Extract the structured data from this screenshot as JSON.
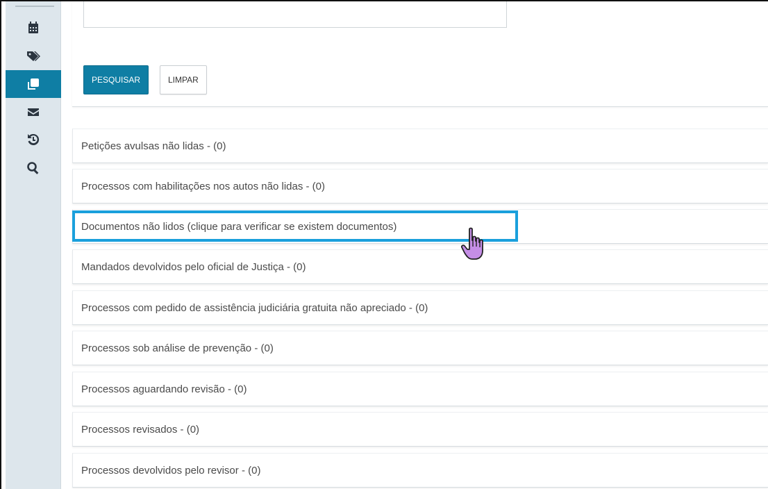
{
  "sidebar": {
    "items": [
      {
        "name": "calendar-icon",
        "active": false
      },
      {
        "name": "tags-icon",
        "active": false
      },
      {
        "name": "clone-icon",
        "active": true
      },
      {
        "name": "envelope-icon",
        "active": false
      },
      {
        "name": "history-icon",
        "active": false
      },
      {
        "name": "search-icon",
        "active": false
      }
    ]
  },
  "search": {
    "query": "",
    "search_button": "PESQUISAR",
    "clear_button": "LIMPAR"
  },
  "list": {
    "items": [
      {
        "label": "Petições avulsas não lidas - (0)"
      },
      {
        "label": "Processos com habilitações nos autos não lidas - (0)"
      },
      {
        "label": "Documentos não lidos (clique para verificar se existem documentos)"
      },
      {
        "label": "Mandados devolvidos pelo oficial de Justiça - (0)"
      },
      {
        "label": "Processos com pedido de assistência judiciária gratuita não apreciado - (0)"
      },
      {
        "label": "Processos sob análise de prevenção - (0)"
      },
      {
        "label": "Processos aguardando revisão - (0)"
      },
      {
        "label": "Processos revisados - (0)"
      },
      {
        "label": "Processos devolvidos pelo revisor - (0)"
      }
    ],
    "highlighted_index": 2
  },
  "colors": {
    "primary": "#0f7ea4",
    "highlight": "#1aa0dc",
    "cursor": "#c58ee6",
    "sidebar_bg": "#dde6ec"
  }
}
